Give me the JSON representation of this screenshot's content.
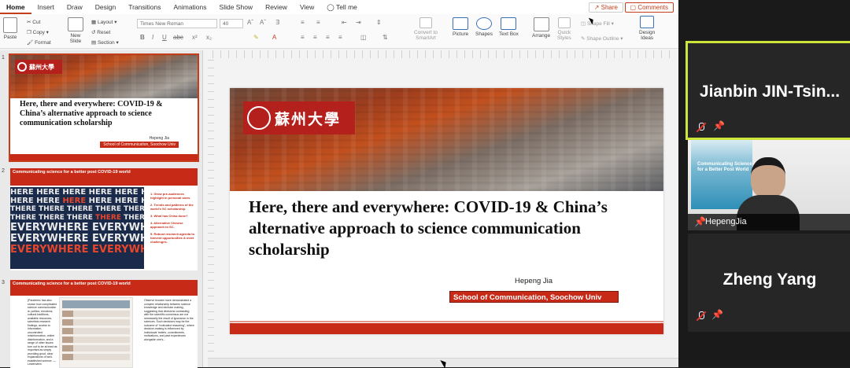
{
  "ribbon": {
    "tabs": [
      "Home",
      "Insert",
      "Draw",
      "Design",
      "Transitions",
      "Animations",
      "Slide Show",
      "Review",
      "View",
      "Tell me"
    ],
    "share": "Share",
    "comments": "Comments",
    "paste": "Paste",
    "cut": "Cut",
    "copy": "Copy",
    "format": "Format",
    "new_slide_line1": "New",
    "new_slide_line2": "Slide",
    "layout": "Layout",
    "reset": "Reset",
    "section": "Section",
    "font_name": "Times New Roman",
    "font_size": "40",
    "convert_line1": "Convert to",
    "convert_line2": "SmartArt",
    "picture": "Picture",
    "shapes": "Shapes",
    "text_box": "Text Box",
    "arrange": "Arrange",
    "quick_styles_line1": "Quick",
    "quick_styles_line2": "Styles",
    "shape_fill": "Shape Fill",
    "shape_outline": "Shape Outline",
    "design_ideas_line1": "Design",
    "design_ideas_line2": "Ideas"
  },
  "thumbnails": [
    {
      "number": "1",
      "logo": "蘇州大學",
      "title": "Here, there and everywhere: COVID-19 & China’s alternative approach to science communication scholarship",
      "author": "Hepeng Jia",
      "school": "School of Communication, Soochow Univ"
    },
    {
      "number": "2",
      "header": "Communicating science for a better post COVID-19 world",
      "words": [
        [
          "HERE HERE HERE HERE HERE HERE HERE HERE",
          ""
        ],
        [
          "HERE HERE ",
          "HERE",
          " HERE HERE HERE"
        ],
        [
          "THERE THERE THERE THERE THERE THERE",
          ""
        ],
        [
          "THERE THERE THERE ",
          "THERE",
          " THERE"
        ],
        [
          "EVERYWHERE EVERYWHERE",
          ""
        ],
        [
          "EVERYWHERE EVERYWHERE",
          ""
        ],
        [
          "EVERYWHERE EVERYWHERE",
          ""
        ]
      ],
      "list": [
        "1. Grow pre-audiences highlight in personal sizes.",
        "2. Trends and patterns of the world's SC scholarship.",
        "3. What has China done?",
        "4. Alternative Chinese approach to SC.",
        "5. Robust research agenda to harvest opportunities & meet challenges."
      ]
    },
    {
      "number": "3",
      "header": "Communicating science for a better post COVID-19 world",
      "col1": "(Pandemic has also shown how complicated science communication is: politics, emotions, cultural traditions, available resources, scientists research findings, access to information, uncontrolled misinformation, online disinformation, and a range of other issues turn out to be at least as important as simply providing good, clear explanations of well-established science. — Lewenstein",
      "col2": "Observe broader have demonstrated a complex relationship between science knowledge and decision making, suggesting that decisions contrasting with the scientific consensus are not necessarily the result of ignorance in the sciences. Such decisions may be the outcome of \"motivated reasoning\", where decision-making is influenced by individuals' beliefs, commitments, motivations, and past experiences alongside one's..."
    }
  ],
  "slide": {
    "logo": "蘇州大學",
    "title": "Here, there and everywhere: COVID-19 & China’s alternative approach to science communication scholarship",
    "author": "Hepeng Jia",
    "school": "School of Communication, Soochow Univ"
  },
  "participants": [
    {
      "name": "Jianbin  JIN-Tsin...",
      "muted": true,
      "pinned": true,
      "active": true
    },
    {
      "name": "HepengJia",
      "muted": false,
      "pinned": true,
      "active": false,
      "video_slide_text": "Communicating Science for a Better Post World"
    },
    {
      "name": "Zheng Yang",
      "muted": true,
      "pinned": true,
      "active": false
    }
  ],
  "colors": {
    "accent": "#c43e1c",
    "brand_red": "#c82a18",
    "active_speaker": "#cde43a"
  }
}
